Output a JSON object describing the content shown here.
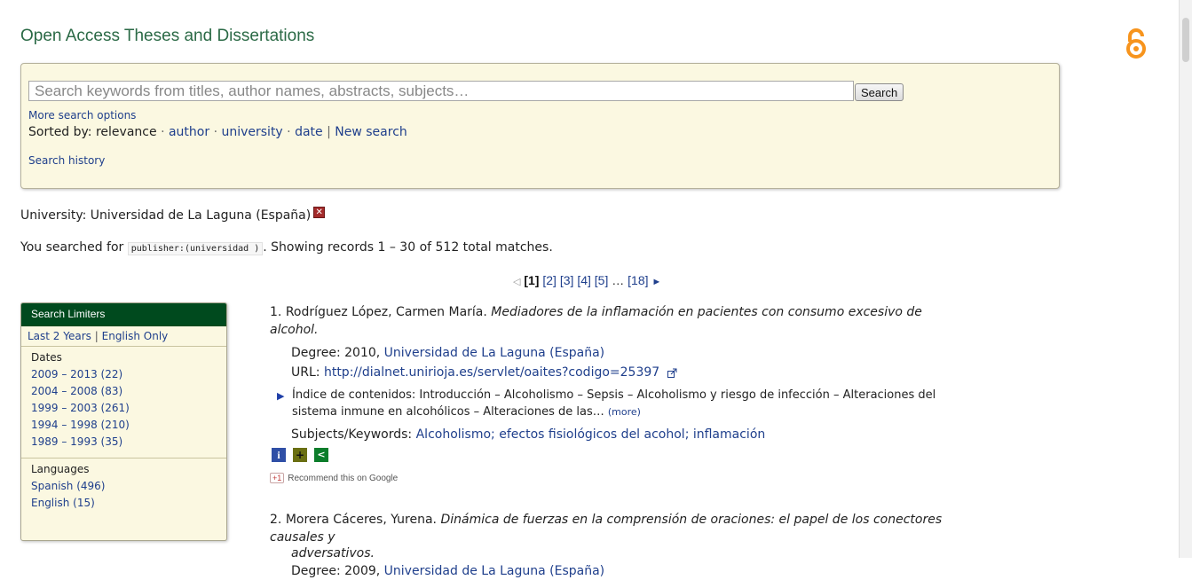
{
  "header": {
    "title": "Open Access Theses and Dissertations",
    "logo_icon": "open-access-icon",
    "logo_color": "#f7941d"
  },
  "search": {
    "placeholder": "Search keywords from titles, author names, abstracts, subjects…",
    "value": "",
    "button_label": "Search",
    "more_options": "More search options",
    "sorted_by_label": "Sorted by:",
    "sort_options": {
      "relevance": "relevance",
      "author": "author",
      "university": "university",
      "date": "date"
    },
    "sort_separator": "·",
    "pipe": "|",
    "new_search": "New search",
    "history": "Search history"
  },
  "filter": {
    "label": "University: Universidad de La Laguna (España)",
    "remove_icon": "remove-filter-icon"
  },
  "query": {
    "prefix": "You searched for",
    "code": "publisher:(universidad )",
    "suffix": ". Showing records 1 – 30 of 512 total matches."
  },
  "pager": {
    "prev": "◁",
    "current": "[1]",
    "pages": [
      "[2]",
      "[3]",
      "[4]",
      "[5]"
    ],
    "ellipsis": "…",
    "last": "[18]",
    "next": "►"
  },
  "limiters": {
    "title": "Search Limiters",
    "last_years": "Last 2 Years",
    "pipe": "|",
    "english_only": "English Only",
    "dates_label": "Dates",
    "dates": [
      "2009 – 2013 (22)",
      "2004 – 2008 (83)",
      "1999 – 2003 (261)",
      "1994 – 1998 (210)",
      "1989 – 1993 (35)"
    ],
    "languages_label": "Languages",
    "languages": [
      "Spanish (496)",
      "English (15)"
    ]
  },
  "results": [
    {
      "number": "1.",
      "author": "Rodríguez López, Carmen María.",
      "title": "Mediadores de la inflamación en pacientes con consumo excesivo de alcohol.",
      "degree_label": "Degree:",
      "degree_year": "2010,",
      "degree_university": "Universidad de La Laguna (España)",
      "url_label": "URL:",
      "url": "http://dialnet.unirioja.es/servlet/oaites?codigo=25397",
      "abstract": "Índice de contenidos: Introducción – Alcoholismo – Sepsis – Alcoholismo y riesgo de infección – Alteraciones del sistema inmune en alcohólicos – Alteraciones de las…",
      "more": "(more)",
      "subjects_label": "Subjects/Keywords:",
      "subjects": "Alcoholismo; efectos fisiológicos del acohol; inflamación",
      "recommend_badge": "+1",
      "recommend": "Recommend this on Google"
    },
    {
      "number": "2.",
      "author": "Morera Cáceres, Yurena.",
      "title_line1": "Dinámica de fuerzas en la comprensión de oraciones: el papel de los conectores causales y",
      "title_line2": "adversativos.",
      "degree_label": "Degree:",
      "degree_year": "2009,",
      "degree_university": "Universidad de La Laguna (España)"
    }
  ]
}
